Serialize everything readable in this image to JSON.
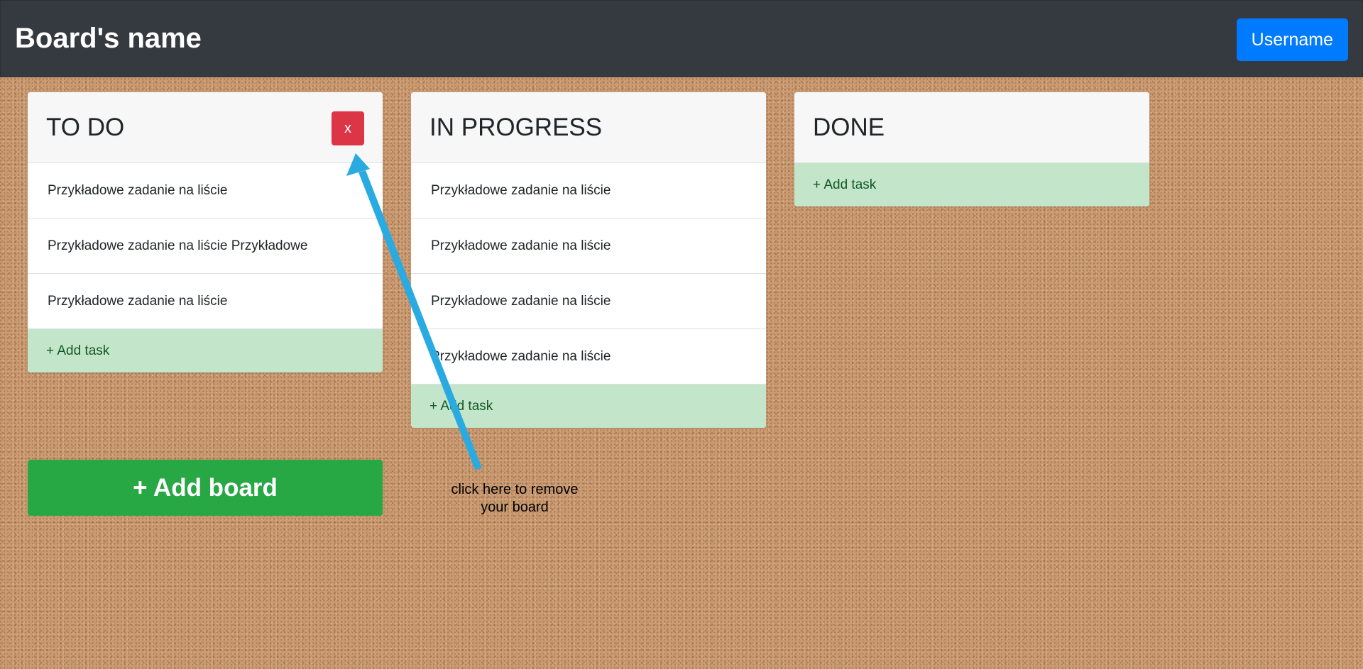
{
  "header": {
    "title": "Board's name",
    "user_button": "Username"
  },
  "boards": [
    {
      "title": "TO DO",
      "remove_label": "x",
      "tasks": [
        "Przykładowe zadanie na liście",
        "Przykładowe zadanie na liście Przykładowe",
        "Przykładowe zadanie na liście"
      ],
      "add_task_label": "+ Add task"
    },
    {
      "title": "IN PROGRESS",
      "tasks": [
        "Przykładowe zadanie na liście",
        "Przykładowe zadanie na liście",
        "Przykładowe zadanie na liście",
        "Przykładowe zadanie na liście"
      ],
      "add_task_label": "+ Add task"
    },
    {
      "title": "DONE",
      "tasks": [],
      "add_task_label": "+ Add task"
    }
  ],
  "add_board_label": "+ Add board",
  "annotation": {
    "line1": "click here to remove",
    "line2": "your board"
  },
  "colors": {
    "navbar": "#343a40",
    "primary": "#007bff",
    "danger": "#dc3545",
    "success": "#28a745",
    "add_task_bg": "#c3e6cb",
    "arrow": "#29abe2"
  }
}
